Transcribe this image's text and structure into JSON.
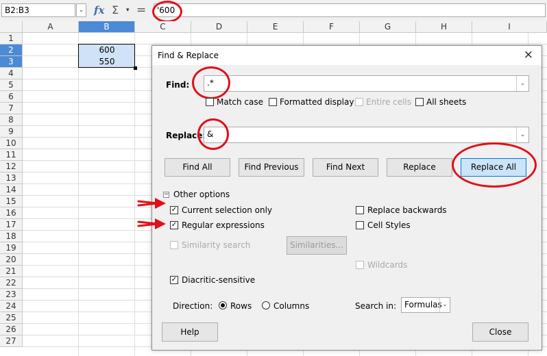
{
  "formula_bar": {
    "name_box": "B2:B3",
    "name_box_arrow": "⌄",
    "fx": "fx",
    "sigma": "Σ",
    "sigma_arrow": "▾",
    "equals": "=",
    "content": "'600"
  },
  "sheet": {
    "columns": [
      "A",
      "B",
      "C",
      "D",
      "E",
      "F",
      "G",
      "H",
      "I"
    ],
    "selected_column": "B",
    "rows": [
      "1",
      "2",
      "3",
      "4",
      "5",
      "6",
      "7",
      "8",
      "9",
      "10",
      "11",
      "12",
      "13",
      "14",
      "15",
      "16",
      "17",
      "18",
      "19",
      "20",
      "21",
      "22",
      "23",
      "24",
      "25",
      "26",
      "27"
    ],
    "selected_rows": [
      "2",
      "3"
    ],
    "cells": {
      "B2": "600",
      "B3": "550"
    },
    "selection_color": "#cfe2f7",
    "header_selected_color": "#4d8ad6"
  },
  "dialog": {
    "title": "Find & Replace",
    "close_icon": "×",
    "find_label": "Find:",
    "find_value": ".*",
    "replace_label": "Replace:",
    "replace_value": "&",
    "dropdown_arrow": "⌄",
    "checkboxes": {
      "match_case": {
        "label": "Match case",
        "checked": false,
        "enabled": true
      },
      "formatted_display": {
        "label": "Formatted display",
        "checked": false,
        "enabled": true
      },
      "entire_cells": {
        "label": "Entire cells",
        "checked": false,
        "enabled": false
      },
      "all_sheets": {
        "label": "All sheets",
        "checked": false,
        "enabled": true
      },
      "current_selection_only": {
        "label": "Current selection only",
        "checked": true,
        "enabled": true
      },
      "regular_expressions": {
        "label": "Regular expressions",
        "checked": true,
        "enabled": true
      },
      "similarity_search": {
        "label": "Similarity search",
        "checked": false,
        "enabled": false
      },
      "replace_backwards": {
        "label": "Replace backwards",
        "checked": false,
        "enabled": true
      },
      "cell_styles": {
        "label": "Cell Styles",
        "checked": false,
        "enabled": true
      },
      "wildcards": {
        "label": "Wildcards",
        "checked": false,
        "enabled": false
      },
      "diacritic_sensitive": {
        "label": "Diacritic-sensitive",
        "checked": true,
        "enabled": true
      }
    },
    "buttons": {
      "find_all": "Find All",
      "find_previous": "Find Previous",
      "find_next": "Find Next",
      "replace": "Replace",
      "replace_all": "Replace All",
      "similarities": "Similarities...",
      "help": "Help",
      "close": "Close"
    },
    "other_options": "Other options",
    "other_options_toggle": "−",
    "direction_label": "Direction:",
    "direction_rows": "Rows",
    "direction_columns": "Columns",
    "direction_selected": "Rows",
    "search_in_label": "Search in:",
    "search_in_value": "Formulas",
    "check_mark": "✓"
  },
  "annotation_color": "#e0101a"
}
